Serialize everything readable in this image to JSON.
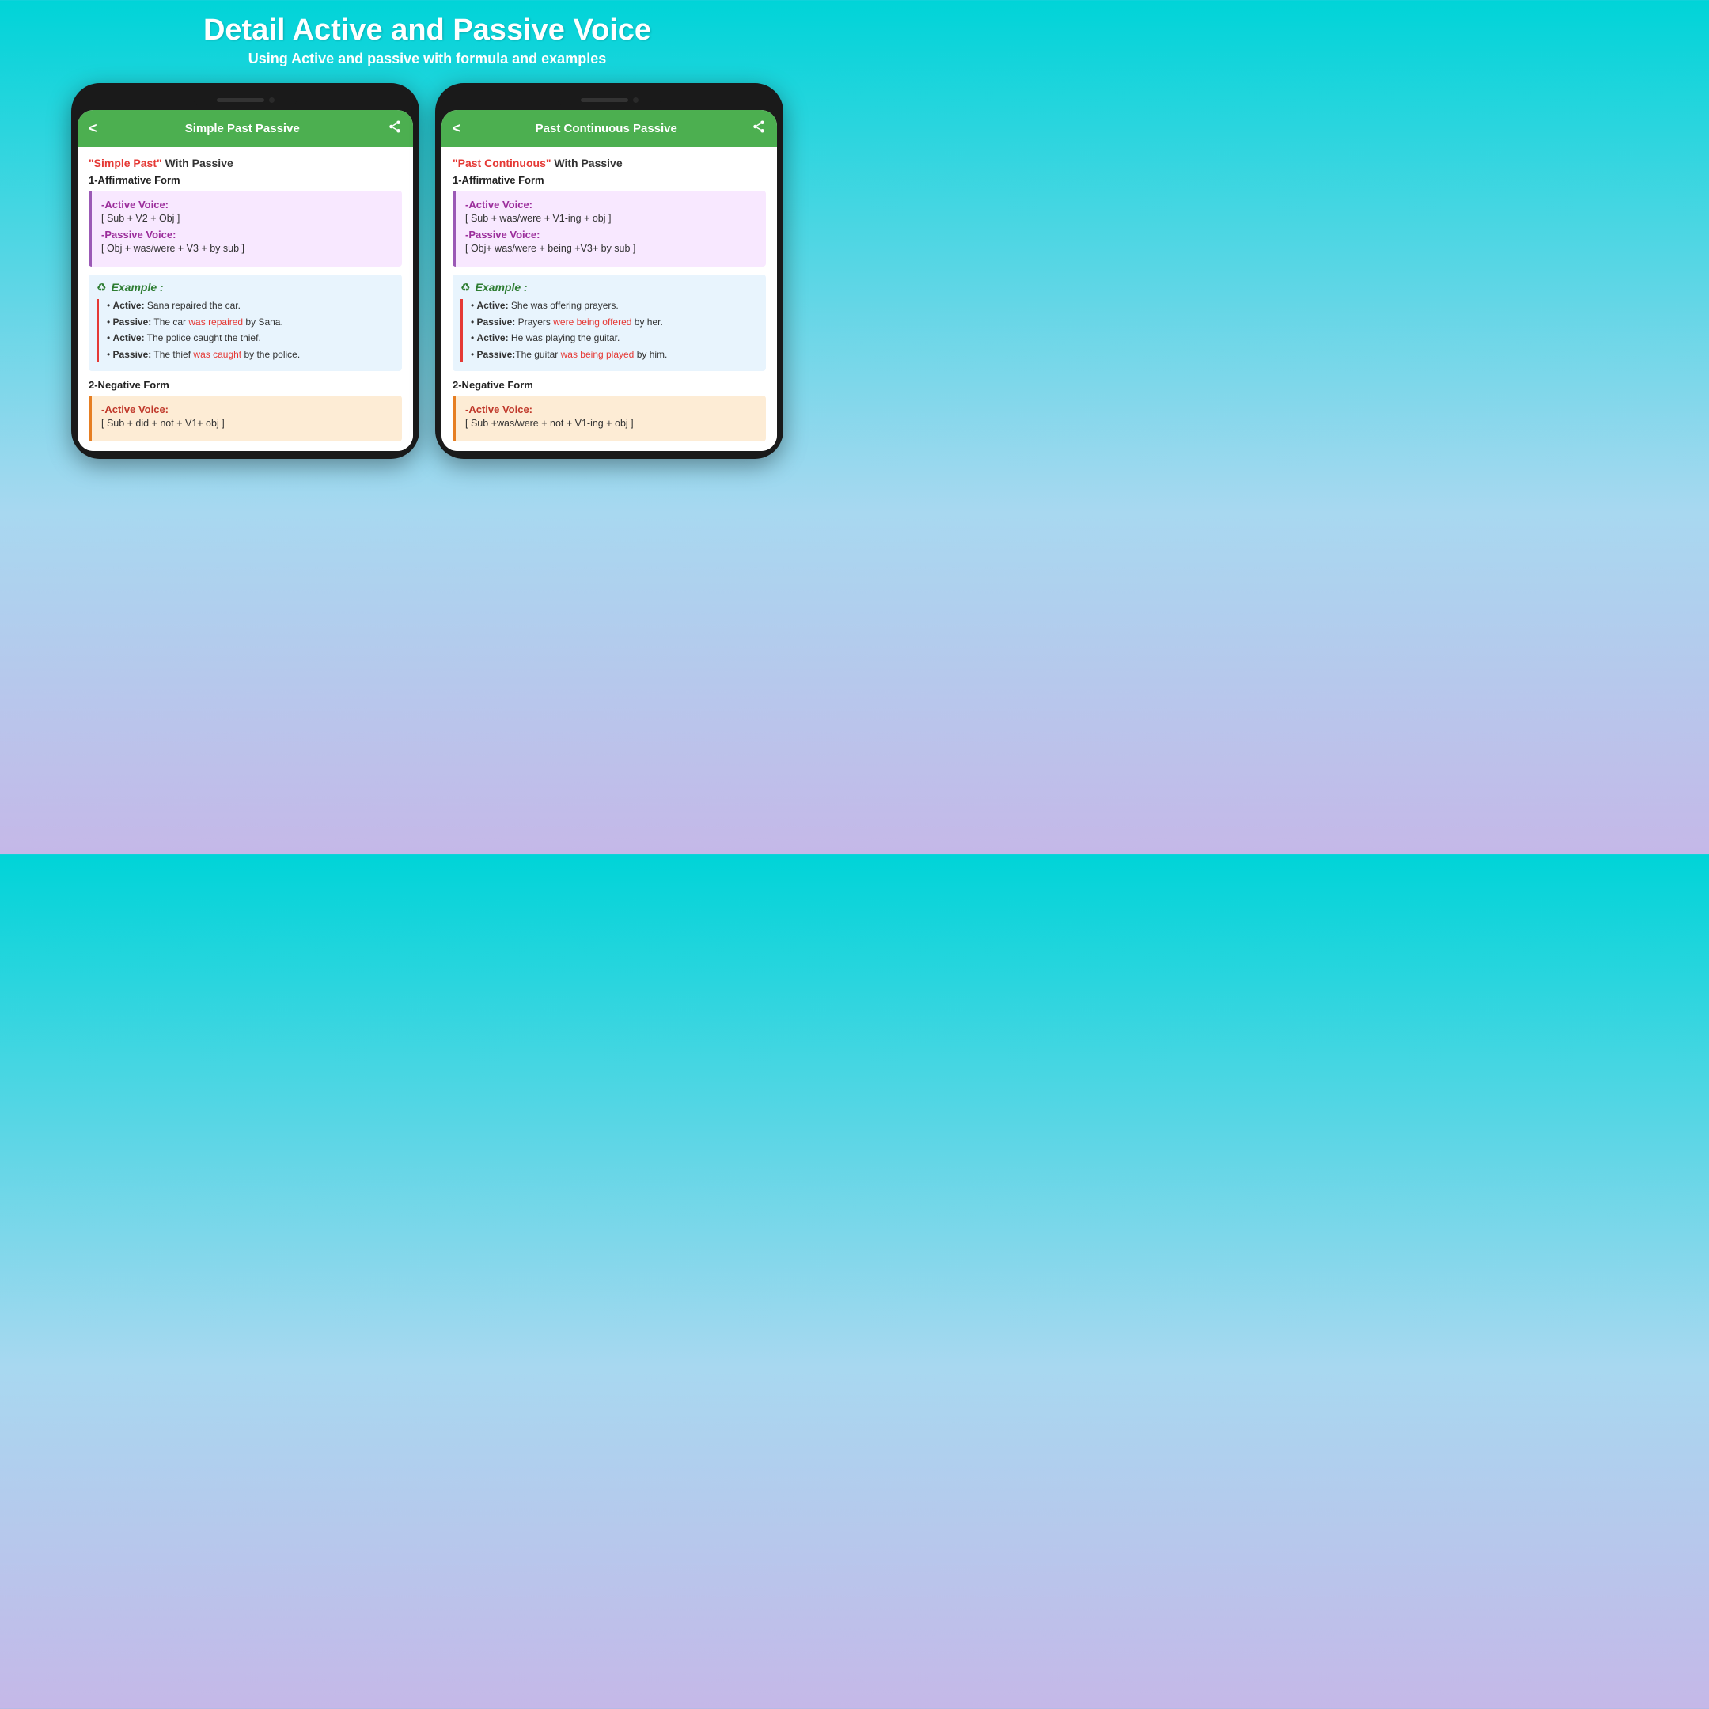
{
  "page": {
    "title": "Detail Active and Passive Voice",
    "subtitle": "Using Active and passive with formula and examples"
  },
  "phone_left": {
    "header": {
      "back": "<",
      "title": "Simple Past Passive",
      "share": "⋮"
    },
    "tense_title_red": "\"Simple Past\"",
    "tense_title_rest": " With Passive",
    "form1_label": "1-Affirmative Form",
    "formula": {
      "active_label": "-Active Voice:",
      "active_formula": "[ Sub + V2 + Obj ]",
      "passive_label": "-Passive Voice:",
      "passive_formula": "[ Obj + was/were + V3 + by sub ]"
    },
    "example_label": "Example :",
    "examples": [
      {
        "bold": "Active:",
        "text": " Sana repaired the car."
      },
      {
        "bold": "Passive:",
        "text": " The car ",
        "red": "was repaired",
        "after": " by Sana."
      },
      {
        "bold": "Active:",
        "text": " The police caught the thief."
      },
      {
        "bold": "Passive:",
        "text": " The thief ",
        "red": "was caught",
        "after": " by the police."
      }
    ],
    "form2_label": "2-Negative Form",
    "neg_formula": {
      "active_label": "-Active Voice:",
      "active_formula": "[ Sub + did + not + V1+ obj ]"
    }
  },
  "phone_right": {
    "header": {
      "back": "<",
      "title": "Past Continuous Passive",
      "share": "⋮"
    },
    "tense_title_red": "\"Past Continuous\"",
    "tense_title_rest": " With Passive",
    "form1_label": "1-Affirmative Form",
    "formula": {
      "active_label": "-Active Voice:",
      "active_formula": "[ Sub + was/were + V1-ing + obj ]",
      "passive_label": "-Passive Voice:",
      "passive_formula": "[ Obj+ was/were + being +V3+ by sub ]"
    },
    "example_label": "Example :",
    "examples": [
      {
        "bold": "Active:",
        "text": " She was offering prayers."
      },
      {
        "bold": "Passive:",
        "text": " Prayers ",
        "red": "were being offered",
        "after": " by her."
      },
      {
        "bold": "Active:",
        "text": " He was playing the guitar."
      },
      {
        "bold": "Passive:",
        "text": "The guitar ",
        "red": "was being played",
        "after": " by him."
      }
    ],
    "form2_label": "2-Negative Form",
    "neg_formula": {
      "active_label": "-Active Voice:",
      "active_formula": "[ Sub +was/were + not + V1-ing + obj ]"
    }
  },
  "colors": {
    "green_header": "#4CAF50",
    "purple_formula_bg": "#f8e8ff",
    "blue_example_bg": "#e8f4fd",
    "orange_neg_bg": "#fdecd5",
    "red_accent": "#e53935",
    "purple_accent": "#9b2d9b"
  }
}
